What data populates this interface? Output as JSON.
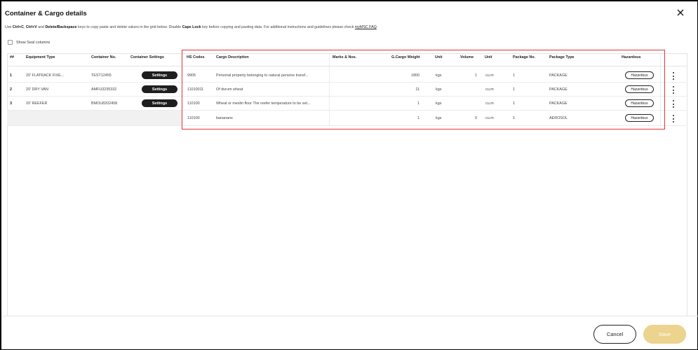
{
  "dialog": {
    "title": "Container & Cargo details",
    "instructions": {
      "t1": "Use ",
      "k1": "Ctrl+C",
      "t2": ", ",
      "k2": "Ctrl+V",
      "t3": " and ",
      "k3": "Delete/Backspace",
      "t4": " keys to copy paste and delete values in the grid below. Disable ",
      "k4": "Caps Lock",
      "t5": " key before copying and pasting data. For additional instructions and guidelines please check ",
      "faq": "myMSC FAQ",
      "t6": "."
    },
    "seal_label": "Show Seal columns",
    "cancel_label": "Cancel",
    "save_label": "Save"
  },
  "table": {
    "headers": {
      "num": "##",
      "equipment": "Equipment Type",
      "container_no": "Container No.",
      "settings": "Container Settings",
      "hs": "HS Codes",
      "desc": "Cargo Description",
      "marks": "Marks & Nos.",
      "weight": "G.Cargo Weight",
      "unit1": "Unit",
      "volume": "Volume",
      "unit2": "Unit",
      "pkg_no": "Package No.",
      "pkg_type": "Package Type",
      "hazardous": "Hazardous"
    },
    "settings_label": "Settings",
    "hazardous_label": "Hazardous",
    "rows": [
      {
        "num": "1",
        "equipment": "20' FLATRACK FIXE...",
        "container_no": "TEST12455",
        "hs": "9905",
        "desc": "Personal property belonging to natural persons transf...",
        "marks": "",
        "weight": "1800",
        "unit1": "kgs",
        "volume": "1",
        "unit2": "cu.m",
        "pkg_no": "1",
        "pkg_type": "PACKAGE"
      },
      {
        "num": "2",
        "equipment": "20' DRY VAN",
        "container_no": "AMFU3235332",
        "hs": "11010011",
        "desc": "Of durum wheat",
        "marks": "",
        "weight": "11",
        "unit1": "kgs",
        "volume": "",
        "unit2": "cu.m",
        "pkg_no": "1",
        "pkg_type": "PACKAGE"
      },
      {
        "num": "3",
        "equipment": "20' REEFER",
        "container_no": "BMOU8202458",
        "hs": "110100",
        "desc": "Wheat or meslin flour The reefer temperature to be set...",
        "marks": "",
        "weight": "1",
        "unit1": "kgs",
        "volume": "",
        "unit2": "cu.m",
        "pkg_no": "1",
        "pkg_type": "PACKAGE"
      },
      {
        "num": "",
        "equipment": "",
        "container_no": "",
        "hs": "110100",
        "desc": "bananans",
        "marks": "",
        "weight": "1",
        "unit1": "kgs",
        "volume": "0",
        "unit2": "cu.m",
        "pkg_no": "1",
        "pkg_type": "AEROSOL"
      }
    ]
  }
}
